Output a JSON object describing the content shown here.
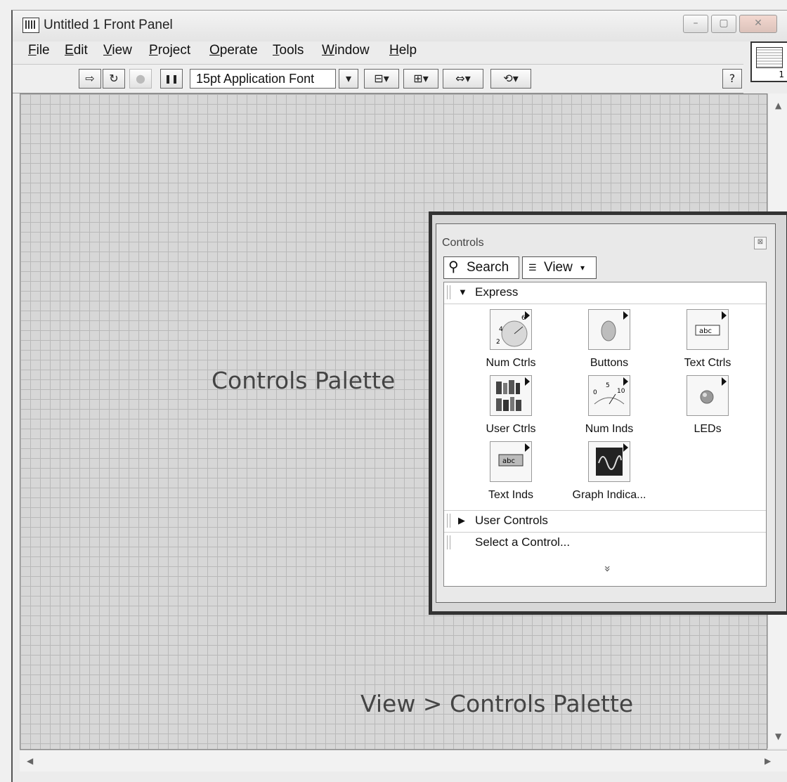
{
  "window": {
    "title": "Untitled 1 Front Panel",
    "minimize": "–",
    "maximize": "▢",
    "close": "✕"
  },
  "menu": [
    {
      "key": "F",
      "rest": "ile"
    },
    {
      "key": "E",
      "rest": "dit"
    },
    {
      "key": "V",
      "rest": "iew"
    },
    {
      "key": "P",
      "rest": "roject"
    },
    {
      "key": "O",
      "rest": "perate"
    },
    {
      "key": "T",
      "rest": "ools"
    },
    {
      "key": "W",
      "rest": "indow"
    },
    {
      "key": "H",
      "rest": "elp"
    }
  ],
  "toolbar": {
    "run": "⇨",
    "run_continuously": "↻",
    "abort": "●",
    "pause": "❚❚",
    "font": "15pt Application Font",
    "font_dropdown": "▾",
    "align": "⊟▾",
    "distribute": "⊞▾",
    "resize": "⇔▾",
    "reorder": "⟲▾",
    "help": "?"
  },
  "connector": {
    "number": "1"
  },
  "labels": {
    "controls_palette": "Controls Palette",
    "view_path": "View > Controls Palette"
  },
  "palette": {
    "title": "Controls",
    "close": "⊠",
    "search": "Search",
    "view": "View",
    "sections": {
      "express": "Express",
      "user_controls": "User Controls",
      "select": "Select a Control..."
    },
    "items": [
      {
        "label": "Num Ctrls",
        "icon": "knob-icon"
      },
      {
        "label": "Buttons",
        "icon": "button-icon"
      },
      {
        "label": "Text Ctrls",
        "icon": "text-control-icon"
      },
      {
        "label": "User Ctrls",
        "icon": "books-icon"
      },
      {
        "label": "Num Inds",
        "icon": "meter-icon"
      },
      {
        "label": "LEDs",
        "icon": "led-icon"
      },
      {
        "label": "Text Inds",
        "icon": "text-indicator-icon"
      },
      {
        "label": "Graph Indica...",
        "icon": "graph-icon"
      }
    ],
    "more": "»"
  }
}
